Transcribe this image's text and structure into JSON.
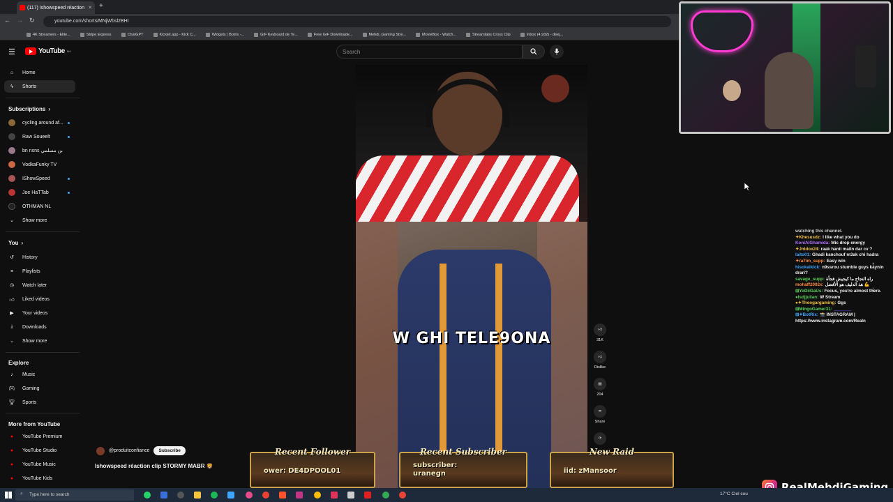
{
  "browser": {
    "tab_title": "(117) Ishowspeed réaction",
    "url": "youtube.com/shorts/MNjWbsl2BHI",
    "bookmarks": [
      "4K Streamers - Elite...",
      "Stripe Express",
      "ChatGPT",
      "Kicklet.app - Kick C...",
      "Widgets | Botrix -...",
      "GIF Keyboard de Te...",
      "Free GIF Downloade...",
      "Mehdi_Gaming Stre...",
      "MovieBox - Watch...",
      "Streamlabs Cross Clip",
      "Inbox (4,932) - deej..."
    ]
  },
  "header": {
    "logo": "YouTube",
    "logo_region": "MA",
    "search_placeholder": "Search"
  },
  "sidebar": {
    "home": "Home",
    "shorts": "Shorts",
    "subscriptions_title": "Subscriptions",
    "subscriptions": [
      {
        "label": "cycling around af..."
      },
      {
        "label": "Raw Soueelt"
      },
      {
        "label": "bn nsns بن مسلمي"
      },
      {
        "label": "VodkaFunky TV"
      },
      {
        "label": "IShowSpeed"
      },
      {
        "label": "Joe HaTTab"
      },
      {
        "label": "OTHMAN NL"
      }
    ],
    "show_more_1": "Show more",
    "you_title": "You",
    "you_items": [
      "History",
      "Playlists",
      "Watch later",
      "Liked videos",
      "Your videos",
      "Downloads"
    ],
    "show_more_2": "Show more",
    "explore_title": "Explore",
    "explore_items": [
      "Music",
      "Gaming",
      "Sports"
    ],
    "more_title": "More from YouTube",
    "more_items": [
      "YouTube Premium",
      "YouTube Studio",
      "YouTube Music",
      "YouTube Kids"
    ]
  },
  "video": {
    "caption": "W GHI TELE9ONA",
    "channel": "@produitconfiance",
    "subscribe": "Subscribe",
    "title": "Ishowspeed réaction clip STORMY MABR 🦁"
  },
  "actions": {
    "like_count": "31K",
    "dislike": "Dislike",
    "comments": "204",
    "share": "Share"
  },
  "chat": [
    {
      "user": "",
      "text": "watching this channel.",
      "color": "#ffffff"
    },
    {
      "user": "✦Khesusdz:",
      "text": "I like what you do",
      "color": "#f0c040"
    },
    {
      "user": "KoniAlGhamida:",
      "text": "Mic drop energy",
      "color": "#b070ff"
    },
    {
      "user": "✦Jnldox24:",
      "text": "raak hanii mailn dar cv ?",
      "color": "#f0c040"
    },
    {
      "user": "laito01:",
      "text": "Ghadi kanchouf m3ak chi hadra",
      "color": "#3ea6ff"
    },
    {
      "user": "✦ra7im_supp:",
      "text": "Easy win",
      "color": "#ff8a3d"
    },
    {
      "user": "hisokaikick:",
      "text": "n9ssrou stumble guys kaynin drari?",
      "color": "#3ea6ff"
    },
    {
      "user": "savage_supp:",
      "text": "راه النجاح ما كيجيش فجأة",
      "color": "#5ad15a"
    },
    {
      "user": "mohaff2002x:",
      "text": "هذ الدليف هو الأفضل 💪",
      "color": "#ff8a3d"
    },
    {
      "user": "⊞YoDiiGaUs:",
      "text": "Focus, you're almost there.",
      "color": "#5ad15a"
    },
    {
      "user": "●Isdjjulian:",
      "text": "W Stream",
      "color": "#5ad15a"
    },
    {
      "user": "●✦Theogargaming:",
      "text": "Ggs",
      "color": "#f0c040"
    },
    {
      "user": "⊞MingoGamer31:",
      "text": "＿＿＿＿",
      "color": "#5ad15a"
    },
    {
      "user": "⊞✦BotRix:",
      "text": "📸 INSTAGRAM | https://www.instagram.com/Realn",
      "color": "#3ea6ff"
    }
  ],
  "panels": [
    {
      "title": "Recent Follower",
      "text": "ower: DE4DPOOL01"
    },
    {
      "title": "Recent Subscriber",
      "text": "subscriber: uranegn"
    },
    {
      "title": "New Raid",
      "text": "iid: zMansoor"
    }
  ],
  "overlay": {
    "instagram": "RealMehdiGaming"
  },
  "taskbar": {
    "search": "Type here to search",
    "weather": "17°C  Ciel cou"
  }
}
